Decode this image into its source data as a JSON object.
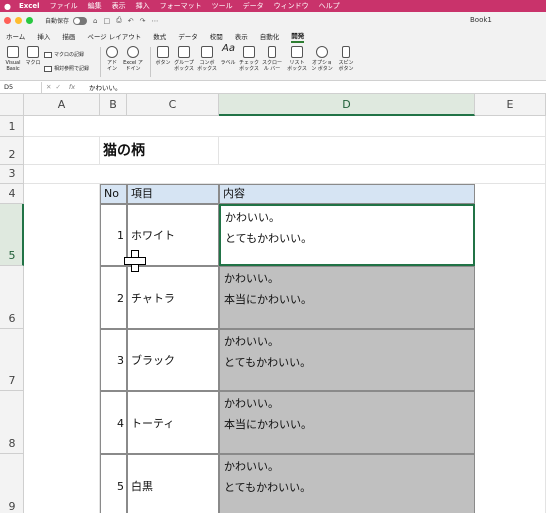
{
  "menubar": {
    "apple": "",
    "items": [
      "Excel",
      "ファイル",
      "編集",
      "表示",
      "挿入",
      "フォーマット",
      "ツール",
      "データ",
      "ウィンドウ",
      "ヘルプ"
    ]
  },
  "titlebar": {
    "autosave_label": "自動保存",
    "doc_title": "Book1"
  },
  "tabs": [
    "ホーム",
    "挿入",
    "描画",
    "ページ レイアウト",
    "数式",
    "データ",
    "校閲",
    "表示",
    "自動化",
    "開発"
  ],
  "active_tab": "開発",
  "ribbon": {
    "visual_basic": "Visual Basic",
    "macro": "マクロ",
    "record_macro": "マクロの記録",
    "relative_ref": "相対参照で記録",
    "addins": "アド イン",
    "excel_addins": "Excel アドイン",
    "controls": [
      "ボタン",
      "グループ ボックス",
      "コンボ ボックス",
      "ラベル",
      "チェック ボックス",
      "スクロール バー",
      "リスト ボックス",
      "オプション ボタン",
      "スピン ボタン"
    ]
  },
  "formula_bar": {
    "name_box": "D5",
    "fx": "fx",
    "content": "かわいい。"
  },
  "columns": [
    "A",
    "B",
    "C",
    "D",
    "E"
  ],
  "rows": [
    "1",
    "2",
    "3",
    "4",
    "5",
    "6",
    "7",
    "8",
    "9"
  ],
  "sheet": {
    "title": "猫の柄",
    "headers": {
      "no": "No",
      "item": "項目",
      "content": "内容"
    },
    "records": [
      {
        "no": "1",
        "item": "ホワイト",
        "line1": "かわいい。",
        "line2": "とてもかわいい。"
      },
      {
        "no": "2",
        "item": "チャトラ",
        "line1": "かわいい。",
        "line2": "本当にかわいい。"
      },
      {
        "no": "3",
        "item": "ブラック",
        "line1": "かわいい。",
        "line2": "とてもかわいい。"
      },
      {
        "no": "4",
        "item": "トーティ",
        "line1": "かわいい。",
        "line2": "本当にかわいい。"
      },
      {
        "no": "5",
        "item": "白黒",
        "line1": "かわいい。",
        "line2": "とてもかわいい。"
      }
    ]
  },
  "colors": {
    "menubar": "#c9336b",
    "header_fill": "#d6e4f3",
    "gray_fill": "#c0c0c0",
    "selection": "#217346"
  }
}
